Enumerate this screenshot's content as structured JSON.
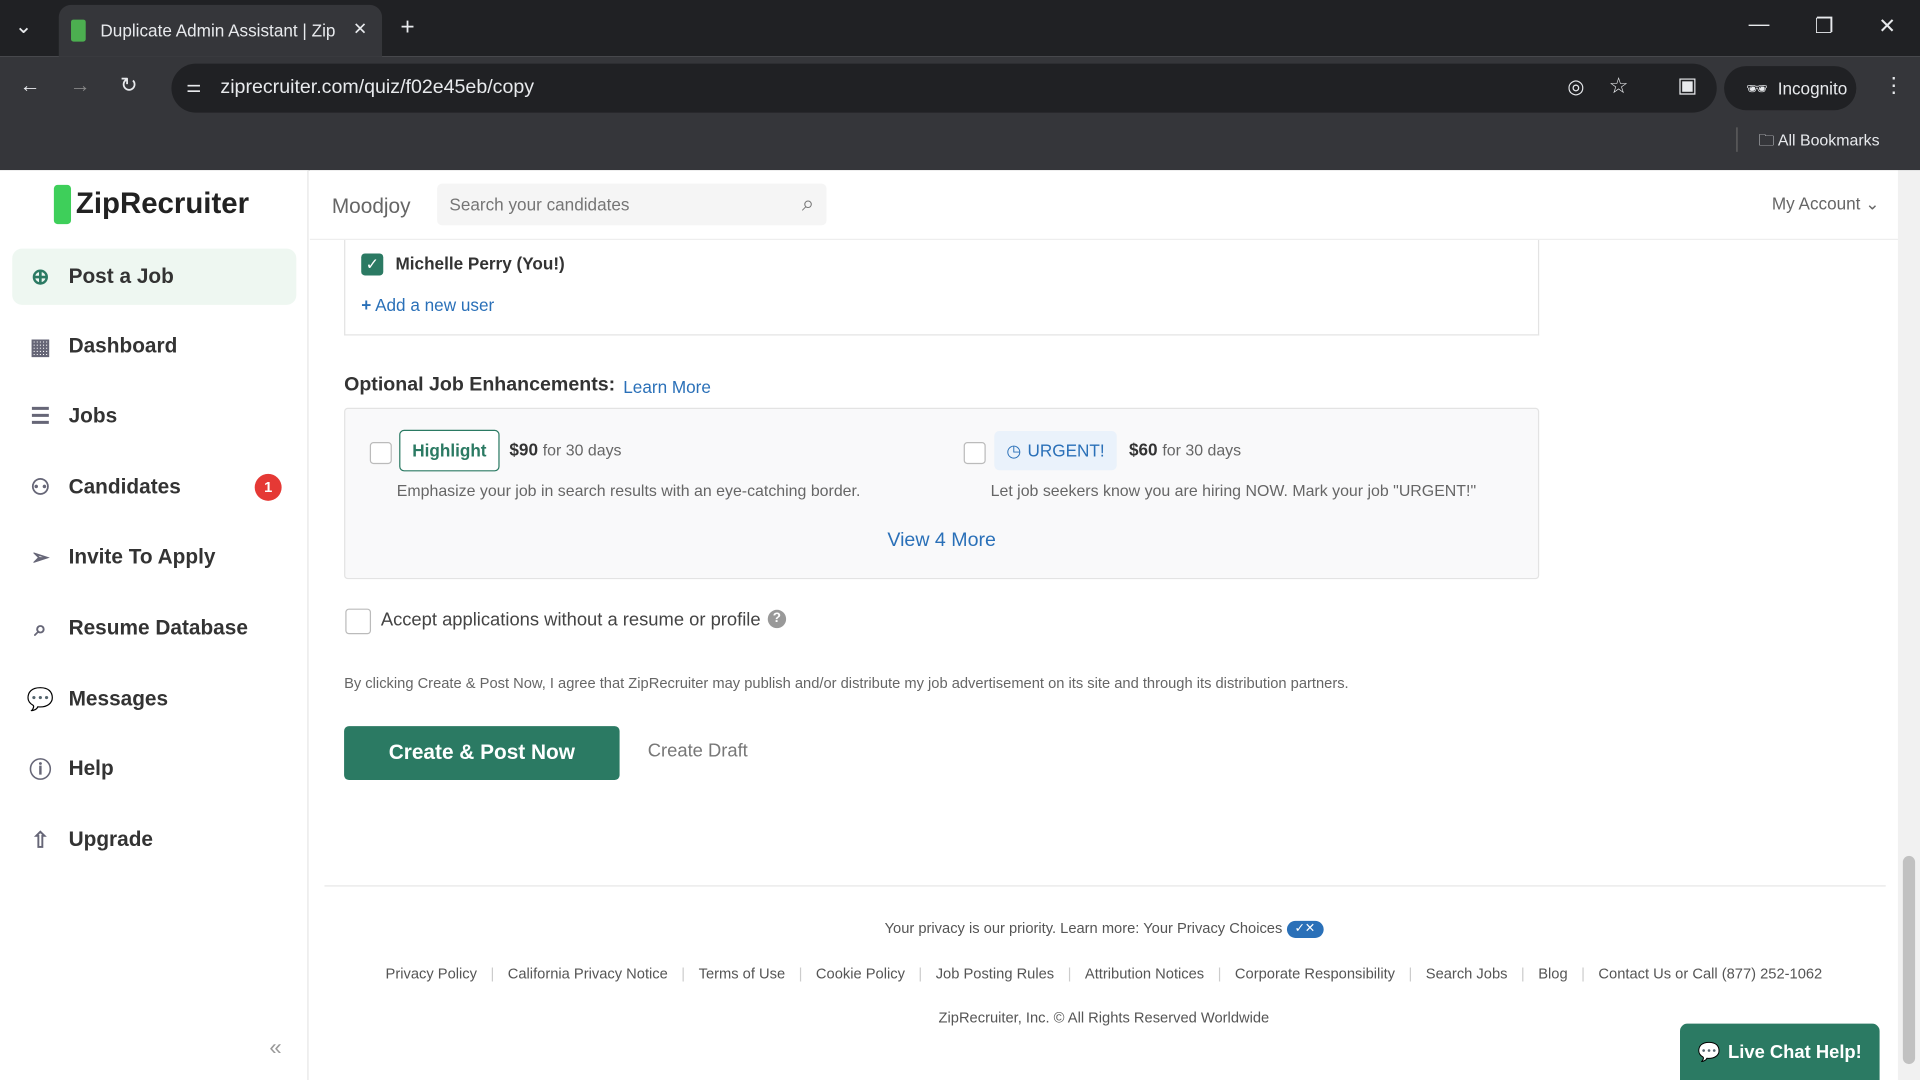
{
  "browser": {
    "tab_title": "Duplicate Admin Assistant | Zip",
    "url": "ziprecruiter.com/quiz/f02e45eb/copy",
    "incognito_label": "Incognito",
    "bookmarks_label": "All Bookmarks"
  },
  "brand": {
    "logo": "ZipRecruiter",
    "accent": "#2b7a63"
  },
  "sidebar": {
    "items": [
      {
        "label": "Post a Job",
        "icon": "plus-circle-icon"
      },
      {
        "label": "Dashboard",
        "icon": "grid-icon"
      },
      {
        "label": "Jobs",
        "icon": "list-icon"
      },
      {
        "label": "Candidates",
        "icon": "users-icon",
        "badge": "1"
      },
      {
        "label": "Invite To Apply",
        "icon": "send-icon"
      },
      {
        "label": "Resume Database",
        "icon": "search-icon"
      },
      {
        "label": "Messages",
        "icon": "chat-icon"
      },
      {
        "label": "Help",
        "icon": "help-icon"
      },
      {
        "label": "Upgrade",
        "icon": "upgrade-icon"
      }
    ]
  },
  "header": {
    "company": "Moodjoy",
    "search_placeholder": "Search your candidates",
    "account": "My Account"
  },
  "users": {
    "checked_user": "Michelle Perry (You!)",
    "add_user": "Add a new user"
  },
  "enhancements": {
    "title": "Optional Job Enhancements:",
    "learn_more": "Learn More",
    "items": [
      {
        "badge": "Highlight",
        "price": "$90",
        "duration": "for 30 days",
        "desc": "Emphasize your job in search results with an eye-catching border.",
        "checked": false
      },
      {
        "badge": "URGENT!",
        "price": "$60",
        "duration": "for 30 days",
        "desc": "Let job seekers know you are hiring NOW. Mark your job \"URGENT!\"",
        "checked": false
      }
    ],
    "view_more": "View 4 More"
  },
  "accept_no_resume": {
    "label": "Accept applications without a resume or profile",
    "checked": false
  },
  "legal": "By clicking Create & Post Now, I agree that ZipRecruiter may publish and/or distribute my job advertisement on its site and through its distribution partners.",
  "actions": {
    "primary": "Create & Post Now",
    "secondary": "Create Draft"
  },
  "footer": {
    "privacy": "Your privacy is our priority. Learn more:",
    "privacy_choices": "Your Privacy Choices",
    "links": [
      "Privacy Policy",
      "California Privacy Notice",
      "Terms of Use",
      "Cookie Policy",
      "Job Posting Rules",
      "Attribution Notices",
      "Corporate Responsibility",
      "Search Jobs",
      "Blog",
      "Contact Us or Call (877) 252-1062"
    ],
    "copyright": "ZipRecruiter, Inc. © All Rights Reserved Worldwide"
  },
  "live_chat": "Live Chat Help!"
}
